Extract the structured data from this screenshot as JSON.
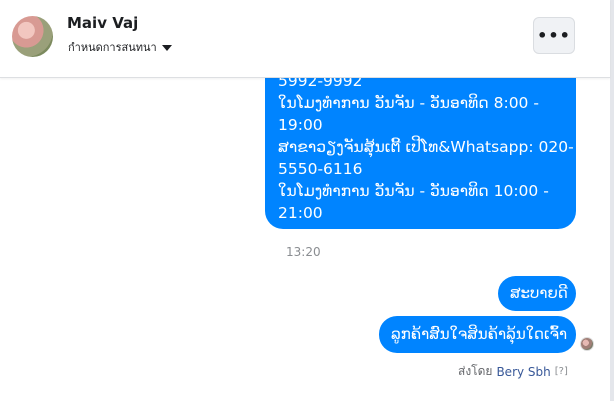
{
  "header": {
    "contact_name": "Maiv Vaj",
    "subtitle": "กำหนดการสนทนา",
    "more_label": "•••"
  },
  "messages": {
    "long_bubble_lines": [
      "5992-9992",
      "ໃນໂມງທຳການ ວັນຈັນ - ວັນອາທິດ  8:00 -",
      "19:00",
      "ສາຂາວຽງຈັນສຸ້ນເຕີ້ ເປີໂທ&Whatsapp: 020-",
      "5550-6116",
      "ໃນໂມງທຳການ ວັນຈັນ - ວັນອາທິດ  10:00 -",
      "21:00"
    ],
    "timestamp": "13:20",
    "greeting": "ສະບາຍດີ",
    "question": "ລູກຄ້າສົນໃຈສິນຄ້າລຸ້ນໃດເຈົ້າ"
  },
  "footer": {
    "sent_by_prefix": "ส่งโดย",
    "sender_name": "Bery Sbh",
    "help": "[?]"
  },
  "colors": {
    "bubble": "#0084ff",
    "header_bg": "#ffffff"
  }
}
